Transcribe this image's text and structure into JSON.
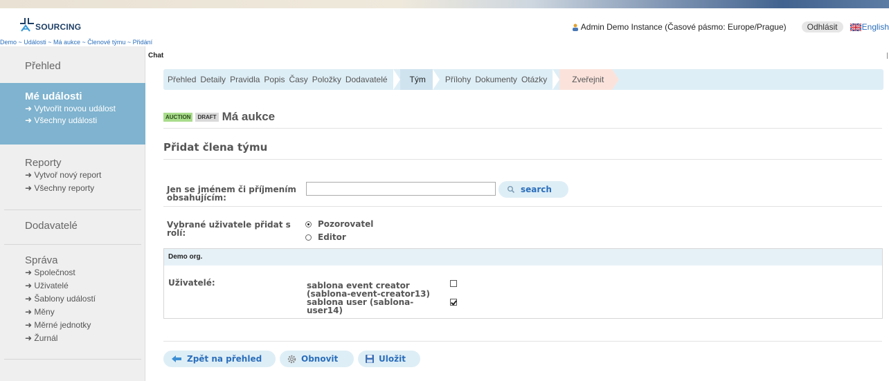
{
  "header": {
    "logo_text": "SOURCING",
    "user_info": "Admin Demo Instance (Časové pásmo: Europe/Prague)",
    "logout_label": "Odhlásit",
    "language_label": "English"
  },
  "breadcrumb": "Demo ~ Události ~ Má aukce ~ Členové týmu ~ Přidání",
  "sidebar": {
    "overview": "Přehled",
    "my_events": {
      "title": "Mé události",
      "links": [
        "Vytvořit novou událost",
        "Všechny události"
      ]
    },
    "reports": {
      "title": "Reporty",
      "links": [
        "Vytvoř nový report",
        "Všechny reporty"
      ]
    },
    "suppliers": "Dodavatelé",
    "admin": {
      "title": "Správa",
      "links": [
        "Společnost",
        "Uživatelé",
        "Šablony událostí",
        "Měny",
        "Měrné jednotky",
        "Žurnál"
      ]
    }
  },
  "chat_label": "Chat",
  "tabs": [
    "Přehled",
    "Detaily",
    "Pravidla",
    "Popis",
    "Časy",
    "Položky",
    "Dodavatelé",
    "Tým",
    "Přílohy",
    "Dokumenty",
    "Otázky",
    "Zveřejnit"
  ],
  "event": {
    "type_badge": "AUCTION",
    "status_badge": "DRAFT",
    "name": "Má aukce"
  },
  "form": {
    "title": "Přidat člena týmu",
    "search_label_line1": "Jen se jménem či příjmením",
    "search_label_line2": "obsahujícím:",
    "search_value": "",
    "search_button": "search",
    "role_label_line1": "Vybrané uživatele přidat s",
    "role_label_line2": "rolí:",
    "roles": [
      {
        "label": "Pozorovatel",
        "selected": true
      },
      {
        "label": "Editor",
        "selected": false
      }
    ],
    "org_name": "Demo org.",
    "users_label": "Uživatelé:",
    "users": [
      {
        "line1": "sablona event creator",
        "line2": "(sablona-event-creator13)",
        "checked": false
      },
      {
        "line1": "sablona user (sablona-",
        "line2": "user14)",
        "checked": true
      }
    ]
  },
  "actions": {
    "back": "Zpět na přehled",
    "refresh": "Obnovit",
    "save": "Uložit"
  }
}
